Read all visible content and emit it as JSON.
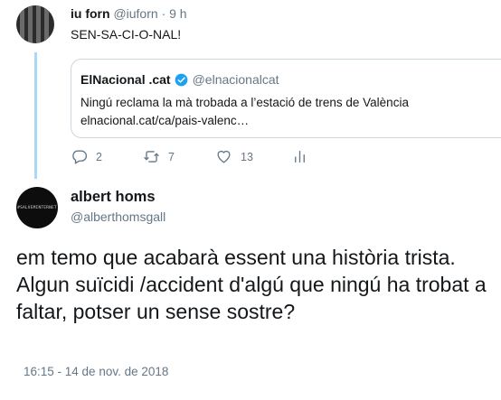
{
  "reply_tweet": {
    "display_name": "iu forn",
    "handle": "@iuforn",
    "separator": "·",
    "time": "9 h",
    "text": "SEN-SA-CI-O-NAL!",
    "quoted": {
      "display_name": "ElNacional .cat",
      "handle": "@elnacionalcat",
      "text_line1": "Ningú reclama la mà trobada a l’estació de trens de València",
      "text_line2": "elnacional.cat/ca/pais-valenc…"
    },
    "actions": {
      "replies": "2",
      "retweets": "7",
      "likes": "13"
    }
  },
  "main_tweet": {
    "avatar_text": "#SALVEMINTERNET",
    "display_name": "albert homs",
    "handle": "@alberthomsgall",
    "text": "em temo que acabarà essent una història trista. Algun suïcidi /accident d'algú que ningú ha trobat a faltar, potser un sense sostre?",
    "timestamp": "16:15 - 14 de nov. de 2018"
  },
  "colors": {
    "thread_line": "#a8d8f6",
    "verified": "#1da1f2",
    "muted": "#657786"
  }
}
